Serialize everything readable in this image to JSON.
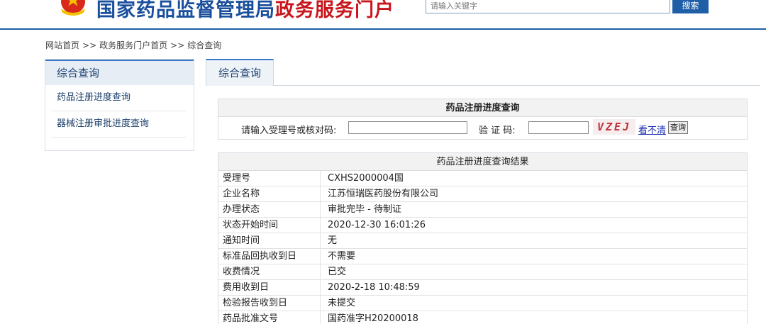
{
  "header": {
    "title_part1": "国家药品监督管理局",
    "title_part2": "政务服务门户",
    "search_placeholder": "请输入关键字",
    "search_button": "搜索",
    "colors": {
      "primary": "#1a4f9c",
      "accent": "#c8161d"
    }
  },
  "breadcrumb": {
    "items": [
      "网站首页",
      "政务服务门户首页",
      "综合查询"
    ],
    "separator": ">>"
  },
  "sidebar": {
    "heading": "综合查询",
    "items": [
      {
        "label": "药品注册进度查询"
      },
      {
        "label": "器械注册审批进度查询"
      }
    ]
  },
  "tabs": [
    {
      "label": "综合查询",
      "active": true
    }
  ],
  "query": {
    "title": "药品注册进度查询",
    "id_label": "请输入受理号或核对码:",
    "id_value": "",
    "verify_label": "验 证 码:",
    "verify_value": "",
    "captcha_text": "VZEJ",
    "unclear_link": "看不清",
    "submit_button": "查询"
  },
  "result": {
    "title": "药品注册进度查询结果",
    "rows": [
      {
        "key": "受理号",
        "value": "CXHS2000004国"
      },
      {
        "key": "企业名称",
        "value": "江苏恒瑞医药股份有限公司"
      },
      {
        "key": "办理状态",
        "value": "审批完毕 - 待制证"
      },
      {
        "key": "状态开始时间",
        "value": "2020-12-30 16:01:26"
      },
      {
        "key": "通知时间",
        "value": "无"
      },
      {
        "key": "标准品回执收到日",
        "value": "不需要"
      },
      {
        "key": "收费情况",
        "value": "已交"
      },
      {
        "key": "费用收到日",
        "value": "2020-2-18 10:48:59"
      },
      {
        "key": "检验报告收到日",
        "value": "未提交"
      },
      {
        "key": "药品批准文号",
        "value": "国药准字H20200018"
      }
    ]
  }
}
